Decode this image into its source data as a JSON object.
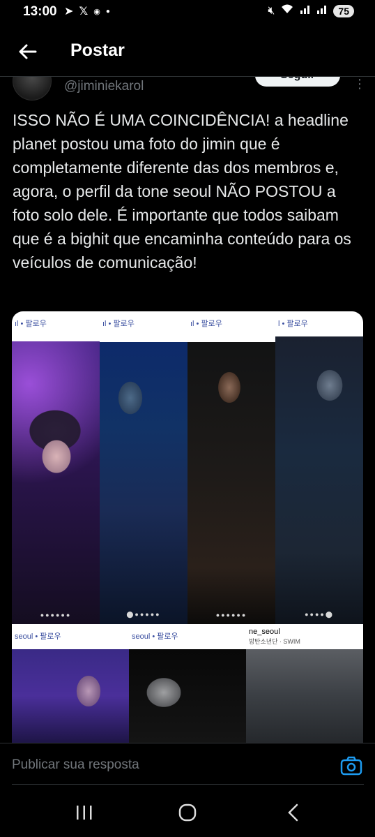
{
  "status_bar": {
    "time": "13:00",
    "left_icons": [
      "telegram-icon",
      "x-icon",
      "app-icon",
      "dot-icon"
    ],
    "right_icons": [
      "mute-icon",
      "wifi-icon",
      "signal-icon",
      "signal-icon"
    ],
    "battery": "75"
  },
  "header": {
    "title": "Postar"
  },
  "author": {
    "handle": "@jiminiekarol",
    "follow_label": "Seguir"
  },
  "tweet": {
    "text": "ISSO NÃO É UMA COINCIDÊNCIA! a headline planet postou uma foto do jimin que é completamente diferente das dos membros e, agora, o perfil da tone seoul NÃO POSTOU a foto solo dele. É importante que todos saibam que é a bighit que encaminha conteúdo para os veículos de comunicação!"
  },
  "media": {
    "panels": [
      {
        "label": "ıl • 팔로우"
      },
      {
        "label": "ıl • 팔로우"
      },
      {
        "label": "ıl • 팔로우"
      },
      {
        "label": "l • 팔로우"
      },
      {
        "label": "seoul • 팔로우"
      },
      {
        "label": "seoul • 팔로우"
      },
      {
        "label": "ne_seoul",
        "sublabel": "방탄소년단 · SWIM"
      }
    ]
  },
  "reply": {
    "placeholder": "Publicar sua resposta"
  }
}
